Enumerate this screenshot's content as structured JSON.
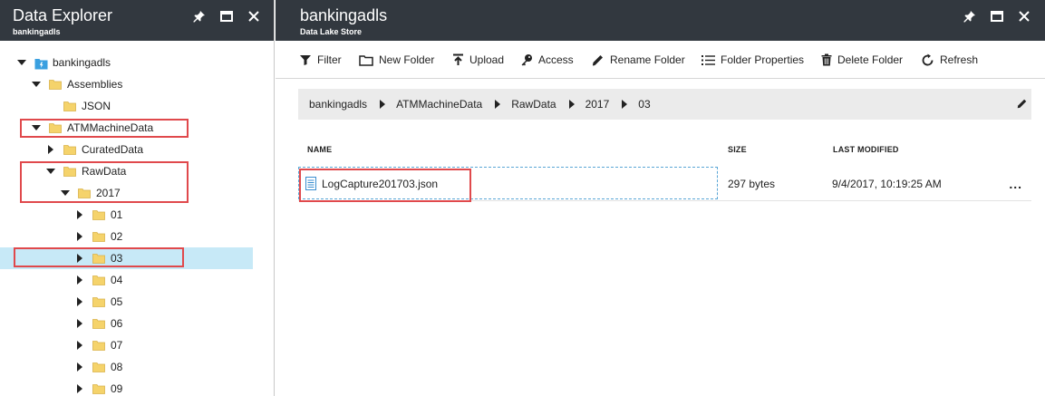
{
  "left_blade": {
    "title": "Data Explorer",
    "subtitle": "bankingadls",
    "controls": [
      "pin-icon",
      "maximize-icon",
      "close-icon"
    ]
  },
  "tree": [
    {
      "label": "bankingadls",
      "level": 0,
      "expanded": true,
      "type": "store"
    },
    {
      "label": "Assemblies",
      "level": 1,
      "expanded": true,
      "type": "folder"
    },
    {
      "label": "JSON",
      "level": 2,
      "expanded": null,
      "type": "folder"
    },
    {
      "label": "ATMMachineData",
      "level": 1,
      "expanded": true,
      "type": "folder"
    },
    {
      "label": "CuratedData",
      "level": 2,
      "expanded": false,
      "type": "folder"
    },
    {
      "label": "RawData",
      "level": 2,
      "expanded": true,
      "type": "folder"
    },
    {
      "label": "2017",
      "level": 3,
      "expanded": true,
      "type": "folder"
    },
    {
      "label": "01",
      "level": 4,
      "expanded": false,
      "type": "folder"
    },
    {
      "label": "02",
      "level": 4,
      "expanded": false,
      "type": "folder"
    },
    {
      "label": "03",
      "level": 4,
      "expanded": false,
      "type": "folder",
      "selected": true
    },
    {
      "label": "04",
      "level": 4,
      "expanded": false,
      "type": "folder"
    },
    {
      "label": "05",
      "level": 4,
      "expanded": false,
      "type": "folder"
    },
    {
      "label": "06",
      "level": 4,
      "expanded": false,
      "type": "folder"
    },
    {
      "label": "07",
      "level": 4,
      "expanded": false,
      "type": "folder"
    },
    {
      "label": "08",
      "level": 4,
      "expanded": false,
      "type": "folder"
    },
    {
      "label": "09",
      "level": 4,
      "expanded": false,
      "type": "folder"
    }
  ],
  "right_blade": {
    "title": "bankingadls",
    "subtitle": "Data Lake Store"
  },
  "toolbar": {
    "filter": "Filter",
    "new_folder": "New Folder",
    "upload": "Upload",
    "access": "Access",
    "rename_folder": "Rename Folder",
    "folder_properties": "Folder Properties",
    "delete_folder": "Delete Folder",
    "refresh": "Refresh"
  },
  "breadcrumb": [
    "bankingadls",
    "ATMMachineData",
    "RawData",
    "2017",
    "03"
  ],
  "table": {
    "headers": {
      "name": "NAME",
      "size": "SIZE",
      "modified": "LAST MODIFIED"
    },
    "rows": [
      {
        "name": "LogCapture201703.json",
        "size": "297 bytes",
        "modified": "9/4/2017, 10:19:25 AM",
        "more": "..."
      }
    ]
  },
  "colors": {
    "header_bg": "#32383f",
    "selection": "#c7e9f7",
    "highlight_box": "#e0494c",
    "folder": "#f5d36b"
  }
}
